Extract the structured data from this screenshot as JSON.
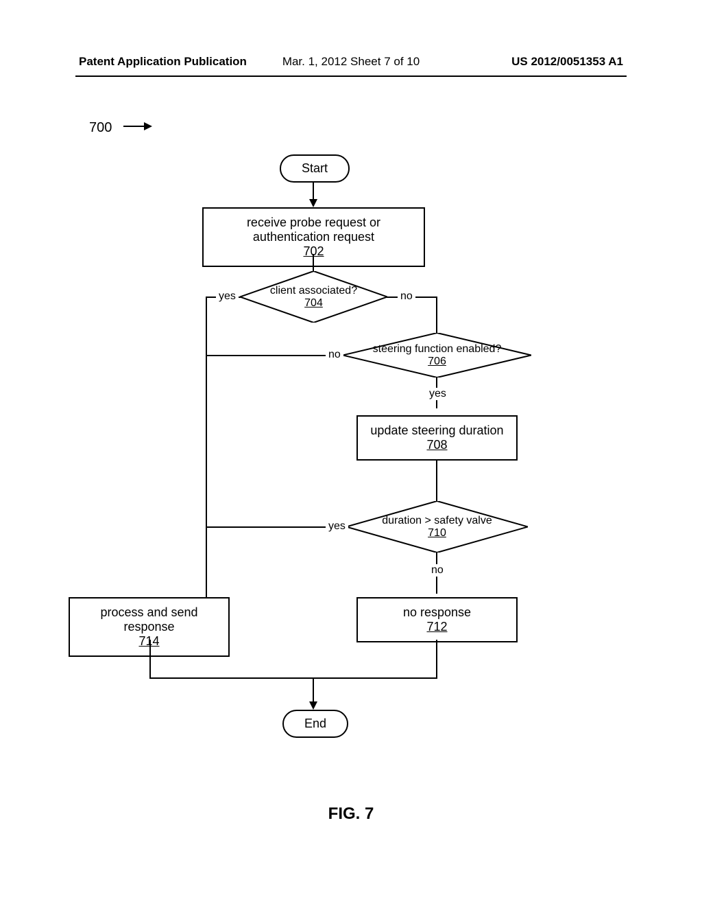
{
  "header": {
    "left": "Patent Application Publication",
    "center": "Mar. 1, 2012   Sheet 7 of 10",
    "right": "US 2012/0051353 A1"
  },
  "diagram": {
    "figure_ref": "700",
    "start": "Start",
    "end": "End",
    "box_702": {
      "text": "receive probe request or authentication request",
      "ref": "702"
    },
    "decision_704": {
      "text": "client associated?",
      "ref": "704",
      "yes": "yes",
      "no": "no"
    },
    "decision_706": {
      "text": "steering function enabled?",
      "ref": "706",
      "yes": "yes",
      "no": "no"
    },
    "box_708": {
      "text": "update steering duration",
      "ref": "708"
    },
    "decision_710": {
      "text": "duration > safety valve",
      "ref": "710",
      "yes": "yes",
      "no": "no"
    },
    "box_712": {
      "text": "no response",
      "ref": "712"
    },
    "box_714": {
      "text": "process and send response",
      "ref": "714"
    }
  },
  "caption": "FIG. 7",
  "chart_data": {
    "type": "flowchart",
    "nodes": [
      {
        "id": "start",
        "type": "terminal",
        "label": "Start"
      },
      {
        "id": "702",
        "type": "process",
        "label": "receive probe request or authentication request"
      },
      {
        "id": "704",
        "type": "decision",
        "label": "client associated?"
      },
      {
        "id": "706",
        "type": "decision",
        "label": "steering function enabled?"
      },
      {
        "id": "708",
        "type": "process",
        "label": "update steering duration"
      },
      {
        "id": "710",
        "type": "decision",
        "label": "duration > safety valve"
      },
      {
        "id": "712",
        "type": "process",
        "label": "no response"
      },
      {
        "id": "714",
        "type": "process",
        "label": "process and send response"
      },
      {
        "id": "end",
        "type": "terminal",
        "label": "End"
      }
    ],
    "edges": [
      {
        "from": "start",
        "to": "702"
      },
      {
        "from": "702",
        "to": "704"
      },
      {
        "from": "704",
        "to": "714",
        "label": "yes"
      },
      {
        "from": "704",
        "to": "706",
        "label": "no"
      },
      {
        "from": "706",
        "to": "714",
        "label": "no"
      },
      {
        "from": "706",
        "to": "708",
        "label": "yes"
      },
      {
        "from": "708",
        "to": "710"
      },
      {
        "from": "710",
        "to": "714",
        "label": "yes"
      },
      {
        "from": "710",
        "to": "712",
        "label": "no"
      },
      {
        "from": "714",
        "to": "end"
      },
      {
        "from": "712",
        "to": "end"
      }
    ]
  }
}
